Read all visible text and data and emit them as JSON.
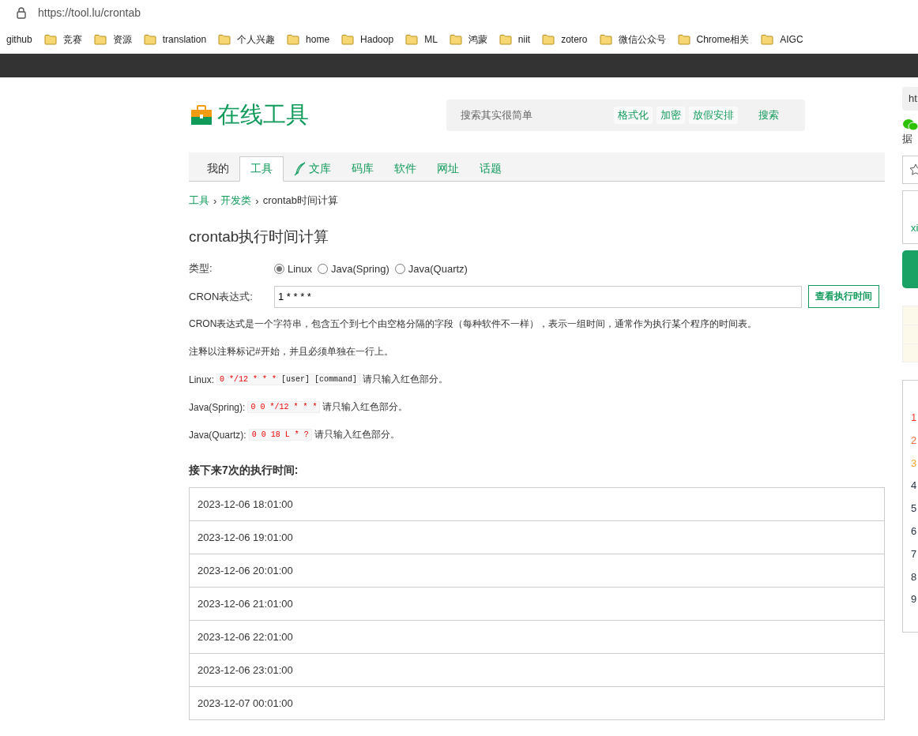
{
  "browser": {
    "url": "https://tool.lu/crontab",
    "bookmarks": [
      {
        "label": "github",
        "kind": "link"
      },
      {
        "label": "竞赛",
        "kind": "folder"
      },
      {
        "label": "资源",
        "kind": "folder"
      },
      {
        "label": "translation",
        "kind": "folder"
      },
      {
        "label": "个人兴趣",
        "kind": "folder"
      },
      {
        "label": "home",
        "kind": "folder"
      },
      {
        "label": "Hadoop",
        "kind": "folder"
      },
      {
        "label": "ML",
        "kind": "folder"
      },
      {
        "label": "鸿蒙",
        "kind": "folder"
      },
      {
        "label": "niit",
        "kind": "folder"
      },
      {
        "label": "zotero",
        "kind": "folder"
      },
      {
        "label": "微信公众号",
        "kind": "folder"
      },
      {
        "label": "Chrome相关",
        "kind": "folder"
      },
      {
        "label": "AIGC",
        "kind": "folder"
      }
    ]
  },
  "header": {
    "logo_text": "在线工具",
    "search": {
      "placeholder": "搜索其实很简单"
    },
    "quick_links": [
      "格式化",
      "加密",
      "放假安排"
    ],
    "search_button": "搜索"
  },
  "nav_tabs": [
    {
      "label": "我的",
      "selected": false,
      "kind": "plain"
    },
    {
      "label": "工具",
      "selected": true,
      "kind": "plain"
    },
    {
      "label": "文库",
      "selected": false,
      "kind": "feather"
    },
    {
      "label": "码库",
      "selected": false,
      "kind": "plain"
    },
    {
      "label": "软件",
      "selected": false,
      "kind": "plain"
    },
    {
      "label": "网址",
      "selected": false,
      "kind": "plain"
    },
    {
      "label": "话题",
      "selected": false,
      "kind": "plain"
    }
  ],
  "breadcrumb": [
    {
      "label": "工具",
      "kind": "link"
    },
    {
      "label": "›",
      "kind": "separator"
    },
    {
      "label": "开发类",
      "kind": "link"
    },
    {
      "label": "›",
      "kind": "separator"
    },
    {
      "label": "crontab时间计算",
      "kind": "current"
    }
  ],
  "title": "crontab执行时间计算",
  "form": {
    "type_label": "类型:",
    "options": [
      {
        "label": "Linux",
        "selected": true
      },
      {
        "label": "Java(Spring)",
        "selected": false
      },
      {
        "label": "Java(Quartz)",
        "selected": false
      }
    ],
    "cron_label": "CRON表达式:",
    "cron_value": "1 * * * *",
    "submit": "查看执行时间"
  },
  "notes": [
    "CRON表达式是一个字符串，包含五个到七个由空格分隔的字段（每种软件不一样），表示一组时间，通常作为执行某个程序的时间表。",
    "注释以注释标记#开始，并且必须单独在一行上。"
  ],
  "examples": [
    {
      "label": "Linux:",
      "red": "0 */12 * * *",
      "plain": "[user] [command]",
      "suffix": "请只输入红色部分。"
    },
    {
      "label": "Java(Spring):",
      "red": "0 0 */12 * * *",
      "suffix": "请只输入红色部分。"
    },
    {
      "label": "Java(Quartz):",
      "red": "0 0 18 L * ?",
      "suffix": "请只输入红色部分。"
    }
  ],
  "results_heading": "接下来7次的执行时间:",
  "results": [
    "2023-12-06 18:01:00",
    "2023-12-06 19:01:00",
    "2023-12-06 20:01:00",
    "2023-12-06 21:01:00",
    "2023-12-06 22:01:00",
    "2023-12-06 23:01:00",
    "2023-12-07 00:01:00"
  ],
  "sidebar": {
    "url_box": "ht",
    "share_text": "据",
    "author_link": "xi",
    "ranks": [
      {
        "label": "1",
        "color": "#ff3b30"
      },
      {
        "label": "2",
        "color": "#ff6a3d"
      },
      {
        "label": "3",
        "color": "#ffa62b"
      },
      {
        "label": "4",
        "color": "#1f2d3d"
      },
      {
        "label": "5",
        "color": "#1f2d3d"
      },
      {
        "label": "6",
        "color": "#1f2d3d"
      },
      {
        "label": "7",
        "color": "#1f2d3d"
      },
      {
        "label": "8",
        "color": "#1f2d3d"
      },
      {
        "label": "9",
        "color": "#1f2d3d"
      }
    ]
  }
}
